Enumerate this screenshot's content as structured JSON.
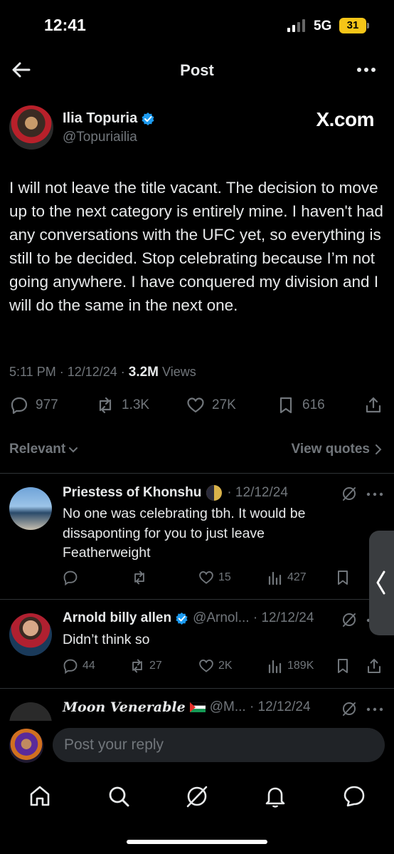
{
  "status_bar": {
    "time": "12:41",
    "network": "5G",
    "battery": "31"
  },
  "header": {
    "title": "Post"
  },
  "post": {
    "author_name": "Ilia Topuria",
    "author_handle": "@Topuriailia",
    "source_badge": "X.com",
    "text": "I will not leave the title vacant. The decision to move up to the next category is entirely mine. I haven't had any conversations with the UFC yet, so everything is still to be decided. Stop celebrating because I’m not going anywhere. I have conquered my division and I will do the same in the next one.",
    "timestamp": "5:11 PM · 12/12/24 · ",
    "views_count": "3.2M",
    "views_label": " Views",
    "replies": "977",
    "reposts": "1.3K",
    "likes": "27K",
    "bookmarks": "616"
  },
  "filter": {
    "sort_label": "Relevant",
    "quotes_label": "View quotes"
  },
  "replies": [
    {
      "name": "Priestess of Khonshu",
      "meta": "· 12/12/24",
      "text": "No one was celebrating tbh. It would be dissaponting for you to just leave Featherweight",
      "replies": "",
      "reposts": "",
      "likes": "15",
      "views": "427"
    },
    {
      "name": "Arnold billy allen",
      "meta": "@Arnol... · 12/12/24",
      "text": "Didn’t think so",
      "replies": "44",
      "reposts": "27",
      "likes": "2K",
      "views": "189K"
    },
    {
      "name": "Moon Venerable",
      "meta": "@M... · 12/12/24"
    }
  ],
  "composer": {
    "placeholder": "Post your reply"
  },
  "colors": {
    "background": "#000000",
    "text": "#e7e9ea",
    "muted": "#71767b",
    "verified": "#1d9bf0",
    "divider": "#2f3336"
  }
}
